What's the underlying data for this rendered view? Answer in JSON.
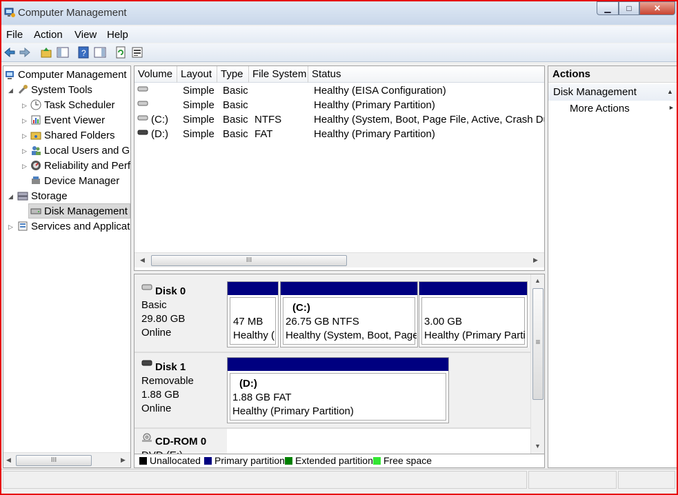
{
  "window": {
    "title": "Computer Management",
    "minimize": "▁",
    "maximize": "□",
    "close": "✕"
  },
  "menu": [
    "File",
    "Action",
    "View",
    "Help"
  ],
  "tree": {
    "root": "Computer Management",
    "system_tools": "System Tools",
    "task_scheduler": "Task Scheduler",
    "event_viewer": "Event Viewer",
    "shared_folders": "Shared Folders",
    "local_users": "Local Users and Gr",
    "reliability": "Reliability and Perf",
    "device_manager": "Device Manager",
    "storage": "Storage",
    "disk_management": "Disk Management",
    "services": "Services and Applicat"
  },
  "volumes": {
    "columns": [
      "Volume",
      "Layout",
      "Type",
      "File System",
      "Status"
    ],
    "rows": [
      {
        "volume": "",
        "layout": "Simple",
        "type": "Basic",
        "fs": "",
        "status": "Healthy (EISA Configuration)"
      },
      {
        "volume": "",
        "layout": "Simple",
        "type": "Basic",
        "fs": "",
        "status": "Healthy (Primary Partition)"
      },
      {
        "volume": "(C:)",
        "layout": "Simple",
        "type": "Basic",
        "fs": "NTFS",
        "status": "Healthy (System, Boot, Page File, Active, Crash Dur"
      },
      {
        "volume": "(D:)",
        "layout": "Simple",
        "type": "Basic",
        "fs": "FAT",
        "status": "Healthy (Primary Partition)"
      }
    ]
  },
  "disks": {
    "disk0": {
      "name": "Disk 0",
      "type": "Basic",
      "size": "29.80 GB",
      "state": "Online",
      "parts": [
        {
          "label": "",
          "size": "47 MB",
          "status": "Healthy ("
        },
        {
          "label": "(C:)",
          "size": "26.75 GB NTFS",
          "status": "Healthy (System, Boot, Page"
        },
        {
          "label": "",
          "size": "3.00 GB",
          "status": "Healthy (Primary Parti"
        }
      ]
    },
    "disk1": {
      "name": "Disk 1",
      "type": "Removable",
      "size": "1.88 GB",
      "state": "Online",
      "parts": [
        {
          "label": "(D:)",
          "size": "1.88 GB FAT",
          "status": "Healthy (Primary Partition)"
        }
      ]
    },
    "cdrom": {
      "name": "CD-ROM 0",
      "type": "DVD (E:)"
    }
  },
  "legend": [
    {
      "label": "Unallocated",
      "color": "#000000"
    },
    {
      "label": "Primary partition",
      "color": "#000080"
    },
    {
      "label": "Extended partition",
      "color": "#008000"
    },
    {
      "label": "Free space",
      "color": "#33e633"
    }
  ],
  "actions": {
    "header": "Actions",
    "section": "Disk Management",
    "more": "More Actions",
    "section_arrow": "▲",
    "more_arrow": "►"
  },
  "scroll": {
    "grip": "III",
    "vgrip": "≡"
  }
}
